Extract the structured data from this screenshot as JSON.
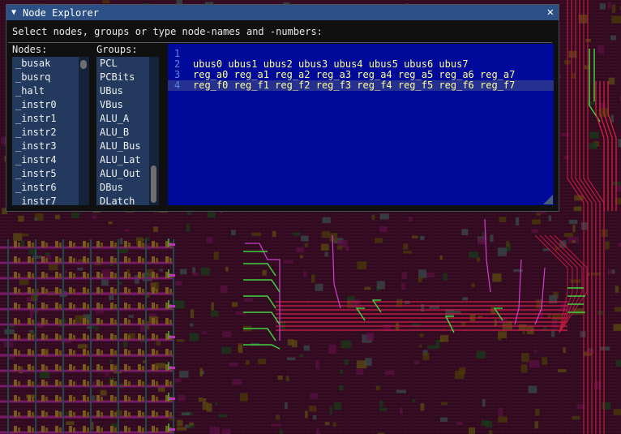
{
  "window": {
    "title": "Node Explorer",
    "collapse_icon": "▼",
    "close_icon": "✕",
    "prompt": "Select nodes, groups or type node-names and -numbers:"
  },
  "nodes": {
    "label": "Nodes:",
    "items": [
      "_busak",
      "_busrq",
      "_halt",
      "_instr0",
      "_instr1",
      "_instr2",
      "_instr3",
      "_instr4",
      "_instr5",
      "_instr6",
      "_instr7"
    ],
    "scroll_fraction": 0.0
  },
  "groups": {
    "label": "Groups:",
    "items": [
      "PCL",
      "PCBits",
      "UBus",
      "VBus",
      "ALU_A",
      "ALU_B",
      "ALU_Bus",
      "ALU_Lat",
      "ALU_Out",
      "DBus",
      "DLatch"
    ],
    "scroll_fraction": 1.0
  },
  "editor": {
    "lines": [
      {
        "num": "1",
        "text": ""
      },
      {
        "num": "2",
        "text": "ubus0 ubus1 ubus2 ubus3 ubus4 ubus5 ubus6 ubus7"
      },
      {
        "num": "3",
        "text": "reg_a0 reg_a1 reg_a2 reg_a3 reg_a4 reg_a5 reg_a6 reg_a7"
      },
      {
        "num": "4",
        "text": "reg_f0 reg_f1 reg_f2 reg_f3 reg_f4 reg_f5 reg_f6 reg_f7"
      }
    ],
    "current_line": 4
  },
  "colors": {
    "titlebar": "#2c4f86",
    "editor_bg": "#000a9a",
    "editor_text": "#ffff9a",
    "line_number": "#5a8ae0",
    "list_bg": "#233a5e"
  }
}
